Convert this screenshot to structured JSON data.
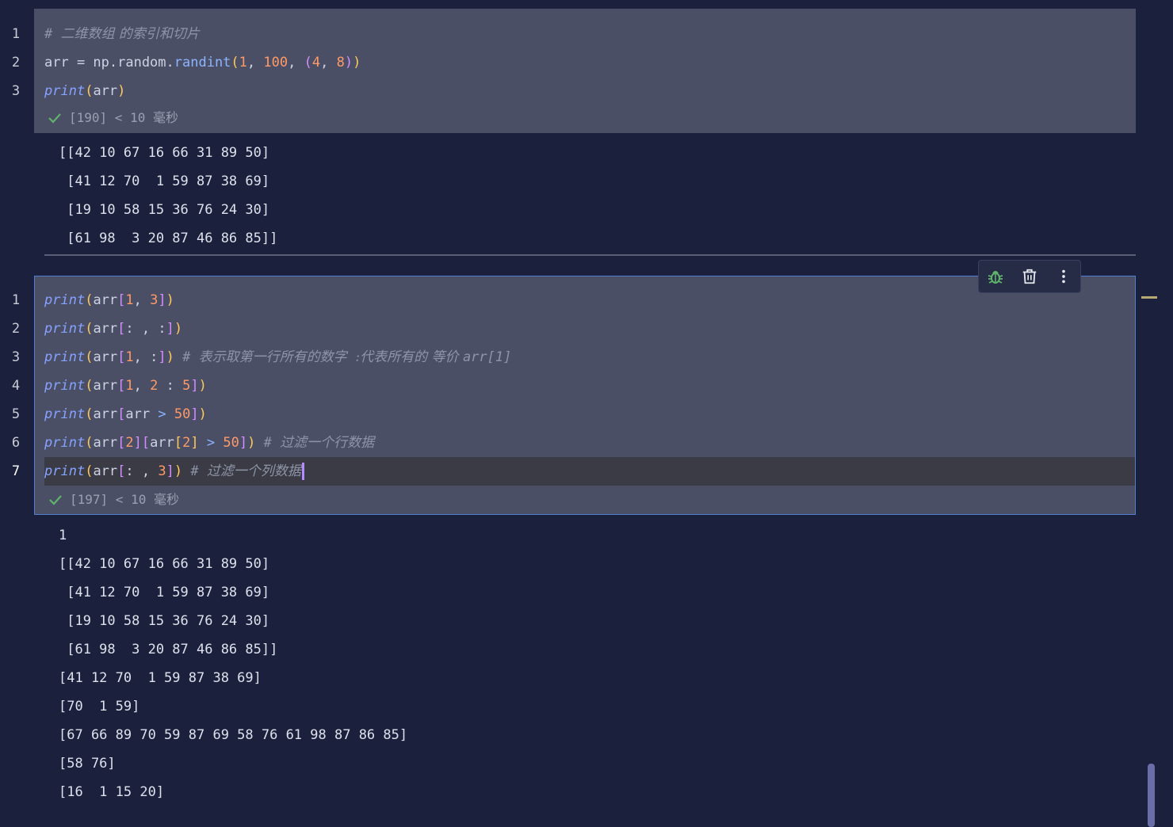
{
  "cell1": {
    "line_numbers": [
      "1",
      "2",
      "3"
    ],
    "lines": [
      [
        {
          "t": "# ",
          "c": "cc"
        },
        {
          "t": "二维数组 的索引和切片",
          "c": "c"
        }
      ],
      [
        {
          "t": "arr = np.random.",
          "c": "t"
        },
        {
          "t": "randint",
          "c": "f"
        },
        {
          "t": "(",
          "c": "p1"
        },
        {
          "t": "1",
          "c": "n"
        },
        {
          "t": ", ",
          "c": "t"
        },
        {
          "t": "100",
          "c": "n"
        },
        {
          "t": ", ",
          "c": "t"
        },
        {
          "t": "(",
          "c": "p2"
        },
        {
          "t": "4",
          "c": "n"
        },
        {
          "t": ", ",
          "c": "t"
        },
        {
          "t": "8",
          "c": "n"
        },
        {
          "t": ")",
          "c": "p2"
        },
        {
          "t": ")",
          "c": "p1"
        }
      ],
      [
        {
          "t": "print",
          "c": "k"
        },
        {
          "t": "(",
          "c": "p1"
        },
        {
          "t": "arr",
          "c": "t"
        },
        {
          "t": ")",
          "c": "p1"
        }
      ]
    ],
    "status": "[190] < 10 毫秒",
    "output": [
      "[[42 10 67 16 66 31 89 50]",
      " [41 12 70  1 59 87 38 69]",
      " [19 10 58 15 36 76 24 30]",
      " [61 98  3 20 87 46 86 85]]"
    ]
  },
  "cell2": {
    "line_numbers": [
      "1",
      "2",
      "3",
      "4",
      "5",
      "6",
      "7"
    ],
    "active_line": 6,
    "lines": [
      [
        {
          "t": "print",
          "c": "k"
        },
        {
          "t": "(",
          "c": "p1"
        },
        {
          "t": "arr",
          "c": "t"
        },
        {
          "t": "[",
          "c": "p2"
        },
        {
          "t": "1",
          "c": "n"
        },
        {
          "t": ", ",
          "c": "t"
        },
        {
          "t": "3",
          "c": "n"
        },
        {
          "t": "]",
          "c": "p2"
        },
        {
          "t": ")",
          "c": "p1"
        }
      ],
      [
        {
          "t": "print",
          "c": "k"
        },
        {
          "t": "(",
          "c": "p1"
        },
        {
          "t": "arr",
          "c": "t"
        },
        {
          "t": "[",
          "c": "p2"
        },
        {
          "t": ": , :",
          "c": "t"
        },
        {
          "t": "]",
          "c": "p2"
        },
        {
          "t": ")",
          "c": "p1"
        }
      ],
      [
        {
          "t": "print",
          "c": "k"
        },
        {
          "t": "(",
          "c": "p1"
        },
        {
          "t": "arr",
          "c": "t"
        },
        {
          "t": "[",
          "c": "p2"
        },
        {
          "t": "1",
          "c": "n"
        },
        {
          "t": ", :",
          "c": "t"
        },
        {
          "t": "]",
          "c": "p2"
        },
        {
          "t": ")",
          "c": "p1"
        },
        {
          "t": " # ",
          "c": "cc"
        },
        {
          "t": "表示取第一行所有的数字  :代表所有的 等价 ",
          "c": "c"
        },
        {
          "t": "arr[1]",
          "c": "cc"
        }
      ],
      [
        {
          "t": "print",
          "c": "k"
        },
        {
          "t": "(",
          "c": "p1"
        },
        {
          "t": "arr",
          "c": "t"
        },
        {
          "t": "[",
          "c": "p2"
        },
        {
          "t": "1",
          "c": "n"
        },
        {
          "t": ", ",
          "c": "t"
        },
        {
          "t": "2",
          "c": "n"
        },
        {
          "t": " : ",
          "c": "t"
        },
        {
          "t": "5",
          "c": "n"
        },
        {
          "t": "]",
          "c": "p2"
        },
        {
          "t": ")",
          "c": "p1"
        }
      ],
      [
        {
          "t": "print",
          "c": "k"
        },
        {
          "t": "(",
          "c": "p1"
        },
        {
          "t": "arr",
          "c": "t"
        },
        {
          "t": "[",
          "c": "p2"
        },
        {
          "t": "arr ",
          "c": "t"
        },
        {
          "t": ">",
          "c": "f"
        },
        {
          "t": " ",
          "c": "t"
        },
        {
          "t": "50",
          "c": "n"
        },
        {
          "t": "]",
          "c": "p2"
        },
        {
          "t": ")",
          "c": "p1"
        }
      ],
      [
        {
          "t": "print",
          "c": "k"
        },
        {
          "t": "(",
          "c": "p1"
        },
        {
          "t": "arr",
          "c": "t"
        },
        {
          "t": "[",
          "c": "p2"
        },
        {
          "t": "2",
          "c": "n"
        },
        {
          "t": "]",
          "c": "p2"
        },
        {
          "t": "[",
          "c": "p2"
        },
        {
          "t": "arr",
          "c": "t"
        },
        {
          "t": "[",
          "c": "p3"
        },
        {
          "t": "2",
          "c": "n"
        },
        {
          "t": "]",
          "c": "p3"
        },
        {
          "t": " ",
          "c": "t"
        },
        {
          "t": ">",
          "c": "f"
        },
        {
          "t": " ",
          "c": "t"
        },
        {
          "t": "50",
          "c": "n"
        },
        {
          "t": "]",
          "c": "p2"
        },
        {
          "t": ")",
          "c": "p1"
        },
        {
          "t": " # ",
          "c": "cc"
        },
        {
          "t": "过滤一个行数据",
          "c": "c"
        }
      ],
      [
        {
          "t": "print",
          "c": "k"
        },
        {
          "t": "(",
          "c": "p1"
        },
        {
          "t": "arr",
          "c": "t"
        },
        {
          "t": "[",
          "c": "p2"
        },
        {
          "t": ": , ",
          "c": "t"
        },
        {
          "t": "3",
          "c": "n"
        },
        {
          "t": "]",
          "c": "p2"
        },
        {
          "t": ")",
          "c": "p1"
        },
        {
          "t": " # ",
          "c": "cc"
        },
        {
          "t": "过滤一个列数据",
          "c": "c"
        }
      ]
    ],
    "status": "[197] < 10 毫秒",
    "output": [
      "1",
      "[[42 10 67 16 66 31 89 50]",
      " [41 12 70  1 59 87 38 69]",
      " [19 10 58 15 36 76 24 30]",
      " [61 98  3 20 87 46 86 85]]",
      "[41 12 70  1 59 87 38 69]",
      "[70  1 59]",
      "[67 66 89 70 59 87 69 58 76 61 98 87 86 85]",
      "[58 76]",
      "[16  1 15 20]"
    ]
  },
  "toolbar": {
    "icons": [
      "bug-icon",
      "trash-icon",
      "more-vertical-icon"
    ]
  },
  "colors": {
    "background": "#1b213d",
    "cell_background": "#4a4f66",
    "active_border": "#4f7ed2",
    "success": "#5fb36b"
  }
}
